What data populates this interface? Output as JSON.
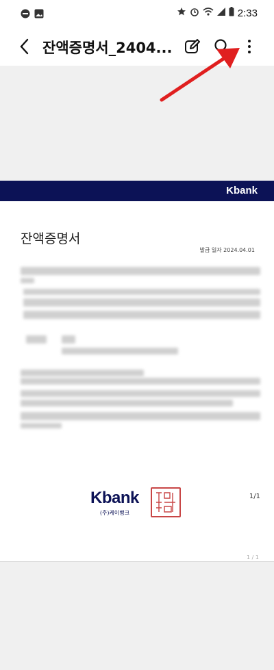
{
  "status_bar": {
    "time": "2:33"
  },
  "app_bar": {
    "title": "잔액증명서_2404..."
  },
  "document": {
    "banner_brand": "Kbank",
    "title": "잔액증명서",
    "issue_date": "발급 일자 2024.04.01",
    "footer_brand": "Kbank",
    "footer_corp": "(주)케이뱅크",
    "page_indicator": "1/1",
    "page_indicator_ghost": "1 / 1"
  },
  "colors": {
    "brand_navy": "#0c1256",
    "annotation_arrow": "#e01f1f",
    "seal_red": "#c84545"
  }
}
